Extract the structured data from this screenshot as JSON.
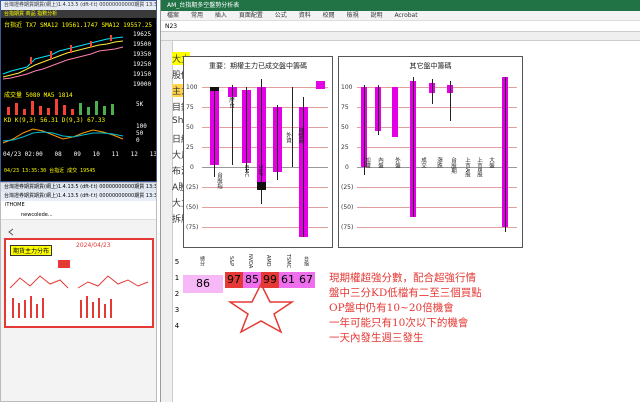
{
  "trade": {
    "title": "台灣證券期貨期貨(網上)1.4.13.5 (dft-f.t) 00000000000期貨 13:35",
    "menu": "台指期貨  商品 指數分析",
    "price_line": "台指近 TX7 SMA12 19561.1747 SMA12 19557.25",
    "right_axis": [
      "19625",
      "19500",
      "19350",
      "19250",
      "19150",
      "19000"
    ],
    "vol_line": "成交量 5080 MA5 1814",
    "vol_axis": "5K",
    "kd_line": "KD K(9,3) 56.31 D(9,3) 67.33",
    "kd_axis": [
      "100",
      "50",
      "0"
    ],
    "dates": [
      "04/23 02:00",
      "08",
      "09",
      "10",
      "11",
      "12",
      "13"
    ],
    "date_bottom": "04/23 13:35:30 台指近  成交 19545"
  },
  "browser": {
    "title": "台灣證券期貨期貨(網上)1.4.13.5 (dft-f.t) 00000000000期貨 13:35",
    "tab": "iTHOME",
    "url": "newcolede...",
    "thumb_title": "期貨主力分布",
    "thumb_red": "2024/04/23"
  },
  "excel": {
    "title": "AM_台指期多空盤勢分析表",
    "menu": [
      "檔案",
      "常用",
      "插入",
      "頁面配置",
      "公式",
      "資料",
      "校閱",
      "檢視",
      "說明",
      "Acrobat"
    ],
    "cell_ref": "N23",
    "left_labels": [
      "大立",
      "股價",
      "主力",
      "目錄",
      "Sheet",
      "日線",
      "大戶",
      "布洛",
      "A股",
      "大立",
      "拆股"
    ],
    "chart1": {
      "title": "重要：期權主力已成交盤中籌碼",
      "y_ticks": [
        "100",
        "75",
        "50",
        "25",
        "0",
        "(25)",
        "(50)",
        "(75)",
        "(100)"
      ],
      "categories": [
        "摩台",
        "台股指",
        "SMC",
        "S&P",
        "外資",
        "自營商",
        "台新金",
        "台股期"
      ]
    },
    "chart2": {
      "title": "其它盤中籌碼",
      "y_ticks": [
        "100",
        "75",
        "50",
        "25",
        "0",
        "(25)",
        "(50)",
        "(75)",
        "(100)"
      ],
      "categories": [
        "加權",
        "內盤",
        "外盤",
        "成交",
        "漲跌",
        "台股期",
        "上市A股",
        "上市B股",
        "大盤",
        "期指"
      ]
    },
    "row_numbers": [
      "5",
      "1",
      "2",
      "3",
      "4"
    ],
    "score_header": [
      "總分",
      "S&P",
      "NVDA",
      "AMD",
      "TSMC",
      "台指"
    ],
    "scores": [
      {
        "value": "86",
        "bg": "#f7b8f7"
      },
      {
        "value": "97",
        "bg": "#e53935"
      },
      {
        "value": "85",
        "bg": "#ee6eee"
      },
      {
        "value": "99",
        "bg": "#e53935"
      },
      {
        "value": "61",
        "bg": "#ee6eee"
      },
      {
        "value": "67",
        "bg": "#ee6eee"
      }
    ],
    "annotation": [
      "現期權超強分數，配合超強行情",
      "盤中三分KD低檔有二至三個買點",
      "OP盤中仍有10~20倍機會",
      "一年可能只有10次以下的機會",
      "一天內發生週三發生"
    ],
    "annotation_color": "#e53935",
    "star_color": "#e53935"
  }
}
